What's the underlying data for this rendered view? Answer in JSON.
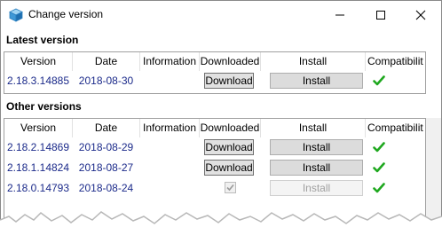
{
  "window": {
    "title": "Change version",
    "controls": {
      "minimize": "minimize",
      "maximize": "maximize",
      "close": "close"
    }
  },
  "latest": {
    "heading": "Latest version",
    "columns": [
      "Version",
      "Date",
      "Information",
      "Downloaded",
      "Install",
      "Compatibilit"
    ],
    "rows": [
      {
        "version": "2.18.3.14885",
        "date": "2018-08-30",
        "information": "",
        "download_label": "Download",
        "install_label": "Install",
        "downloaded": false,
        "install_enabled": true,
        "compatible": true
      }
    ]
  },
  "others": {
    "heading": "Other versions",
    "columns": [
      "Version",
      "Date",
      "Information",
      "Downloaded",
      "Install",
      "Compatibilit"
    ],
    "rows": [
      {
        "version": "2.18.2.14869",
        "date": "2018-08-29",
        "information": "",
        "download_label": "Download",
        "install_label": "Install",
        "downloaded": false,
        "install_enabled": true,
        "compatible": true
      },
      {
        "version": "2.18.1.14824",
        "date": "2018-08-27",
        "information": "",
        "download_label": "Download",
        "install_label": "Install",
        "downloaded": false,
        "install_enabled": true,
        "compatible": true
      },
      {
        "version": "2.18.0.14793",
        "date": "2018-08-24",
        "information": "",
        "download_label": "",
        "install_label": "Install",
        "downloaded": true,
        "install_enabled": false,
        "compatible": true
      }
    ]
  },
  "colors": {
    "link_text": "#1b2a8a",
    "check_green": "#1fa81f",
    "button_face": "#e1e1e1",
    "border": "#a0a0a0"
  },
  "icons": {
    "app": "cube-icon",
    "compatible": "check-icon"
  }
}
